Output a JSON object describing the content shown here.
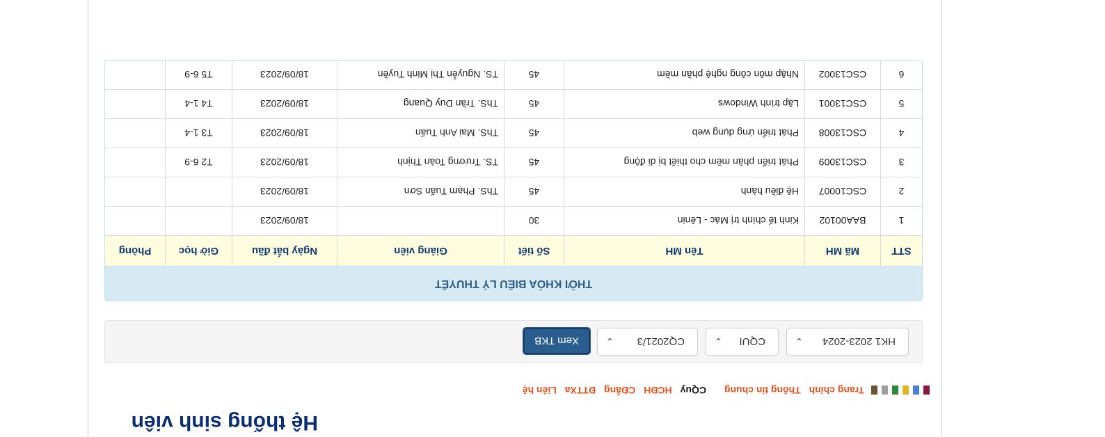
{
  "site": {
    "title": "Hệ thống sinh viên"
  },
  "nav": {
    "swatch_colors": [
      "#8b1a3d",
      "#4a7fd4",
      "#e0b526",
      "#2b8a3e",
      "#9e9e9e",
      "#6b5433"
    ],
    "items": [
      {
        "label": "Trang chính"
      },
      {
        "label": "Thông tin chung"
      },
      {
        "label": "CQuy"
      },
      {
        "label": "HCĐH"
      },
      {
        "label": "CĐẳng"
      },
      {
        "label": "ĐTTXa"
      },
      {
        "label": "Liên hệ"
      }
    ]
  },
  "filters": {
    "semester": "HK1 2023-2024",
    "program": "CQUI",
    "class": "CQ2021/3",
    "view_button": "Xem TKB"
  },
  "timetable": {
    "title": "THỜI KHÓA BIỂU LÝ THUYẾT",
    "columns": [
      "STT",
      "Mã MH",
      "Tên MH",
      "Số tiết",
      "Giảng viên",
      "Ngày bắt đầu",
      "Giờ học",
      "Phòng"
    ],
    "rows": [
      {
        "stt": "1",
        "ma": "BAA00102",
        "ten": "Kinh tế chính trị Mác - Lênin",
        "so_tiet": "30",
        "gv": "",
        "ngay": "18/09/2023",
        "gio": "",
        "phong": ""
      },
      {
        "stt": "2",
        "ma": "CSC10007",
        "ten": "Hệ điều hành",
        "so_tiet": "45",
        "gv": "ThS. Phạm Tuấn Sơn",
        "ngay": "18/09/2023",
        "gio": "",
        "phong": ""
      },
      {
        "stt": "3",
        "ma": "CSC13009",
        "ten": "Phát triển phần mềm cho thiết bị di động",
        "so_tiet": "45",
        "gv": "TS. Trương Toàn Thịnh",
        "ngay": "18/09/2023",
        "gio": "T2 6-9",
        "phong": ""
      },
      {
        "stt": "4",
        "ma": "CSC13008",
        "ten": "Phát triển ứng dụng web",
        "so_tiet": "45",
        "gv": "ThS. Mai Anh Tuấn",
        "ngay": "18/09/2023",
        "gio": "T3 1-4",
        "phong": ""
      },
      {
        "stt": "5",
        "ma": "CSC13001",
        "ten": "Lập trình Windows",
        "so_tiet": "45",
        "gv": "ThS. Trần Duy Quang",
        "ngay": "18/09/2023",
        "gio": "T4 1-4",
        "phong": ""
      },
      {
        "stt": "6",
        "ma": "CSC13002",
        "ten": "Nhập môn công nghệ phần mềm",
        "so_tiet": "45",
        "gv": "TS. Nguyễn Thị Minh Tuyền",
        "ngay": "18/09/2023",
        "gio": "T5 6-9",
        "phong": ""
      }
    ]
  }
}
